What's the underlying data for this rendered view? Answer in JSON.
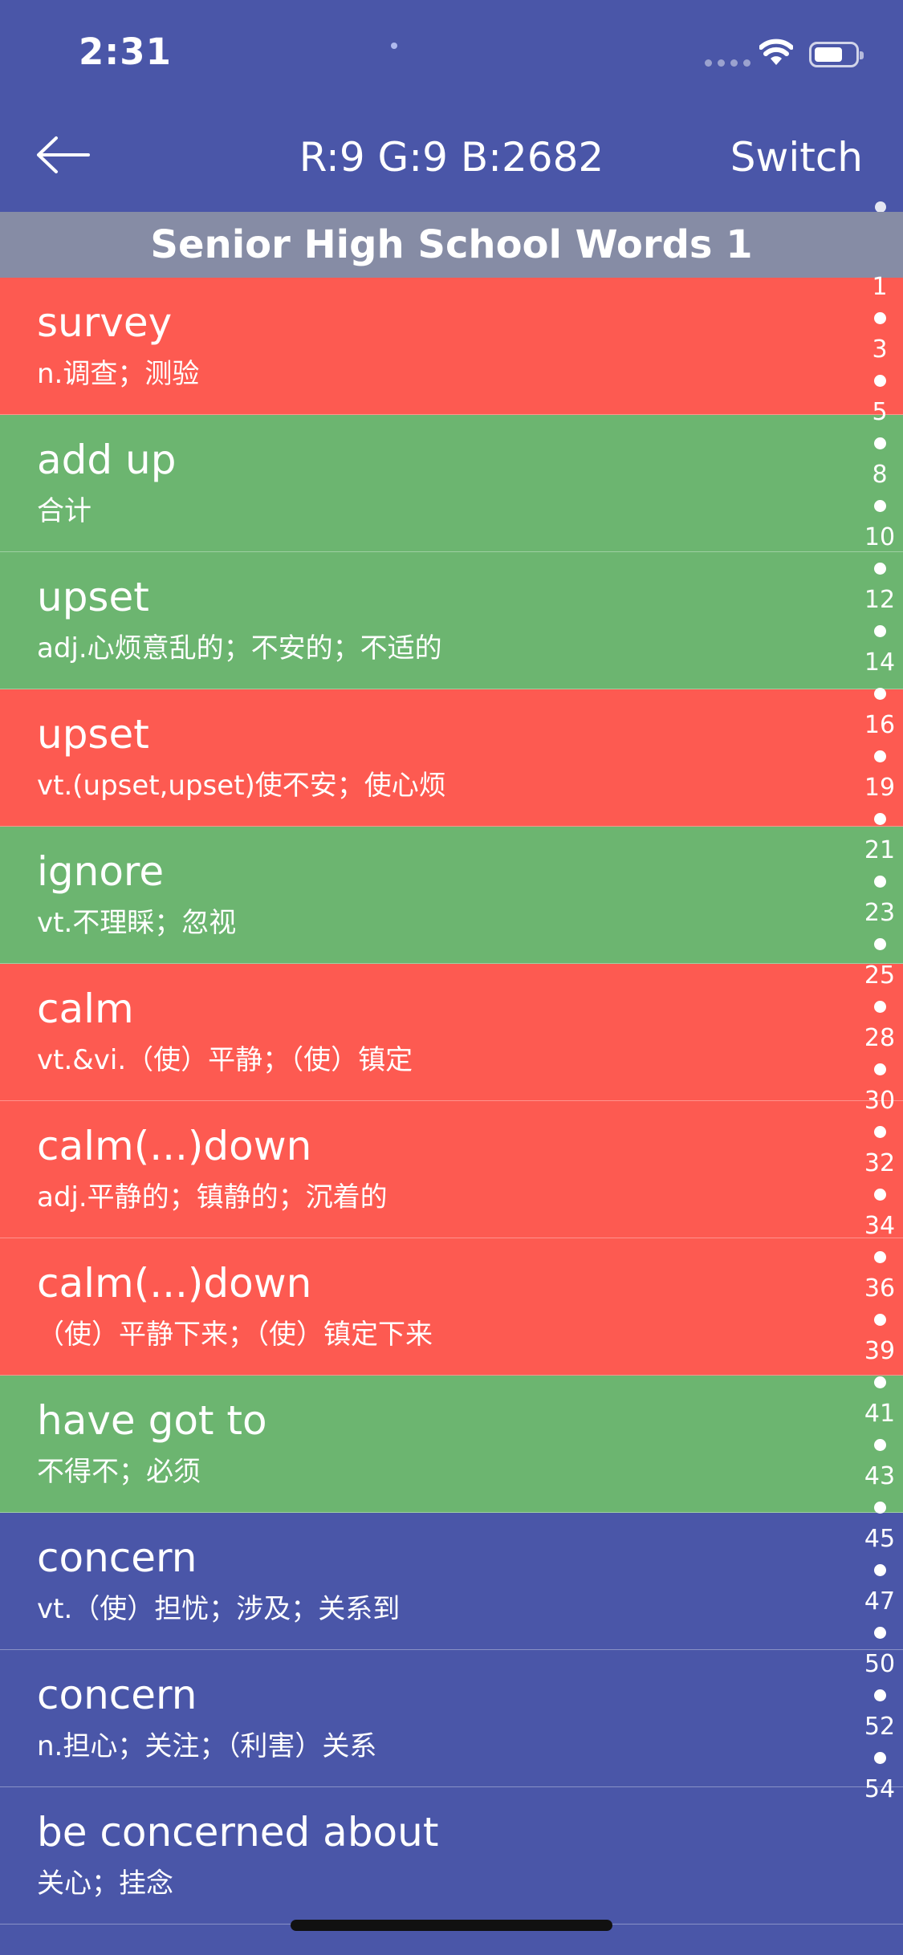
{
  "status_bar": {
    "time": "2:31"
  },
  "nav": {
    "title": "R:9 G:9 B:2682",
    "switch_label": "Switch"
  },
  "section": {
    "title": "Senior High School Words 1"
  },
  "words": [
    {
      "term": "survey",
      "definition": "n.调查；测验",
      "status": "red"
    },
    {
      "term": "add up",
      "definition": "合计",
      "status": "green"
    },
    {
      "term": "upset",
      "definition": "adj.心烦意乱的；不安的；不适的",
      "status": "green"
    },
    {
      "term": "upset",
      "definition": "vt.(upset,upset)使不安；使心烦",
      "status": "red"
    },
    {
      "term": "ignore",
      "definition": "vt.不理睬；忽视",
      "status": "green"
    },
    {
      "term": "calm",
      "definition": "vt.&vi.（使）平静；（使）镇定",
      "status": "red"
    },
    {
      "term": "calm(...)down",
      "definition": "adj.平静的；镇静的；沉着的",
      "status": "red"
    },
    {
      "term": "calm(...)down",
      "definition": "（使）平静下来；（使）镇定下来",
      "status": "red"
    },
    {
      "term": "have got to",
      "definition": "不得不；必须",
      "status": "green"
    },
    {
      "term": "concern",
      "definition": "vt.（使）担忧；涉及；关系到",
      "status": "blue"
    },
    {
      "term": "concern",
      "definition": "n.担心；关注；（利害）关系",
      "status": "blue"
    },
    {
      "term": "be concerned about",
      "definition": "关心；挂念",
      "status": "blue"
    }
  ],
  "index_bar": [
    "1",
    "3",
    "5",
    "8",
    "10",
    "12",
    "14",
    "16",
    "19",
    "21",
    "23",
    "25",
    "28",
    "30",
    "32",
    "34",
    "36",
    "39",
    "41",
    "43",
    "45",
    "47",
    "50",
    "52",
    "54"
  ],
  "colors": {
    "red": "#fd5a51",
    "green": "#6cb570",
    "blue": "#4a56a8",
    "section_header": "#868ca5"
  },
  "icons": {
    "back": "arrow-left-icon",
    "wifi": "wifi-icon",
    "battery": "battery-icon"
  }
}
